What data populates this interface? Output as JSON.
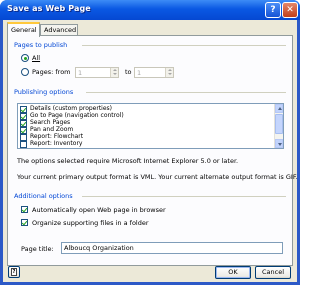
{
  "window": {
    "title": "Save as Web Page",
    "help_glyph": "?",
    "close_glyph": "✕"
  },
  "tabs": [
    {
      "label": "General",
      "active": true
    },
    {
      "label": "Advanced",
      "active": false
    }
  ],
  "pages_to_publish": {
    "heading": "Pages to publish",
    "all_label": "All",
    "pages_label": "Pages: from",
    "to_label": "to",
    "from_value": "1",
    "to_value": "1",
    "selected": "All"
  },
  "publishing_options": {
    "heading": "Publishing options",
    "items": [
      {
        "label": "Details (custom properties)",
        "checked": true
      },
      {
        "label": "Go to Page (navigation control)",
        "checked": true
      },
      {
        "label": "Search Pages",
        "checked": true
      },
      {
        "label": "Pan and Zoom",
        "checked": true
      },
      {
        "label": "Report: Flowchart",
        "checked": false
      },
      {
        "label": "Report: Inventory",
        "checked": false
      }
    ],
    "note_ie": "The options selected require Microsoft Internet Explorer 5.0 or later.",
    "note_format": "Your current primary output format is VML.  Your current alternate output format is GIF."
  },
  "additional_options": {
    "heading": "Additional options",
    "auto_open_label": "Automatically open Web page in browser",
    "auto_open_checked": true,
    "organize_label": "Organize supporting files in a folder",
    "organize_checked": true,
    "page_title_label": "Page title:",
    "page_title_value": "Alboucq Organization"
  },
  "buttons": {
    "ok": "OK",
    "cancel": "Cancel",
    "help_icon": "?"
  },
  "colors": {
    "accent": "#0046d5",
    "title_bar": "#0a58e3",
    "check": "#21a121"
  }
}
